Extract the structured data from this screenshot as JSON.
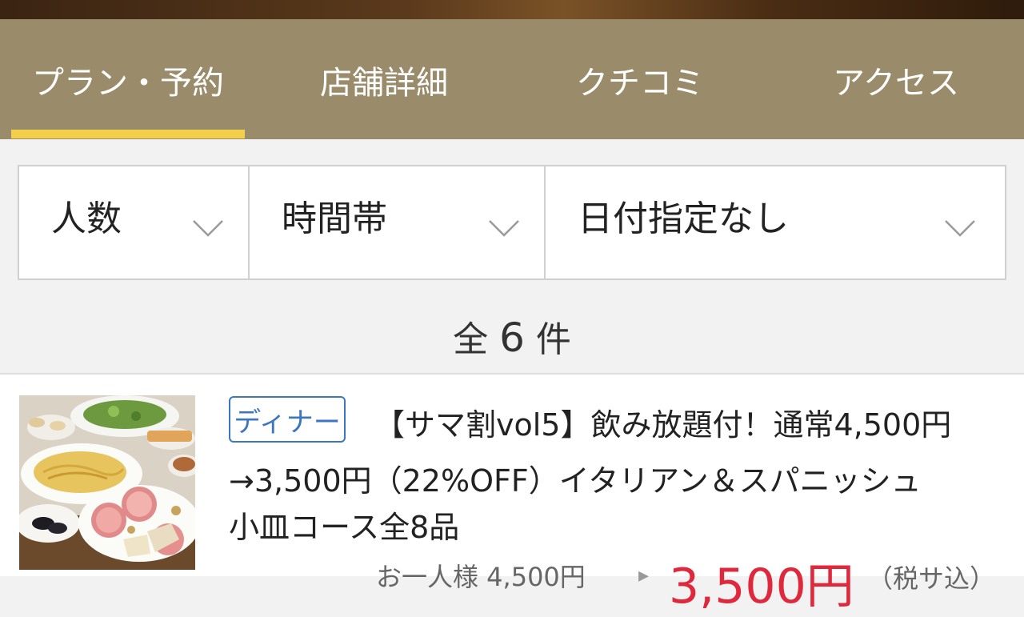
{
  "tabs": {
    "items": [
      {
        "label": "プラン・予約",
        "active": true
      },
      {
        "label": "店舗詳細",
        "active": false
      },
      {
        "label": "クチコミ",
        "active": false
      },
      {
        "label": "アクセス",
        "active": false
      }
    ]
  },
  "filters": {
    "people": "人数",
    "time": "時間帯",
    "date": "日付指定なし"
  },
  "results": {
    "prefix": "全",
    "count": "6",
    "suffix": "件"
  },
  "listing": {
    "badge": "ディナー",
    "title_line1": "【サマ割vol5】飲み放題付！通常4,500円",
    "title_line2": "→3,500円（22%OFF）イタリアン＆スパニッシュ",
    "title_line3": "小皿コース全8品",
    "price_old": "お一人様 4,500円",
    "price_new": "3,500円",
    "price_tax": "（税サ込）"
  },
  "colors": {
    "tabbar": "#9a8c6a",
    "tab_indicator": "#f4cf4a",
    "badge": "#3c76c2",
    "price": "#e0283c"
  }
}
